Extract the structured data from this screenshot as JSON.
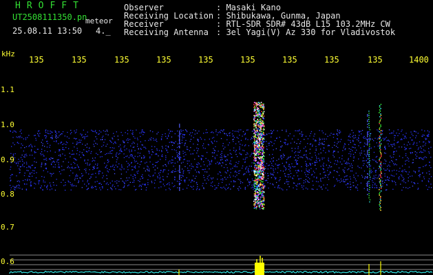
{
  "header": {
    "title": "HROFFT",
    "filename": "UT2508111350.pn",
    "type": "meteor",
    "datetime": "25.08.11 13:50",
    "version": "4._"
  },
  "meta": [
    {
      "label": "Observer",
      "value": ": Masaki Kano"
    },
    {
      "label": "Receiving Location",
      "value": ": Shibukawa, Gunma, Japan"
    },
    {
      "label": "Receiver",
      "value": ": RTL-SDR SDR# 43dB L15 103.2MHz CW"
    },
    {
      "label": "Receiving Antenna",
      "value": ": 3el Yagi(V) Az 330 for Vladivostok"
    }
  ],
  "axis": {
    "y_unit": "kHz",
    "y_ticks": [
      "1.1",
      "1.0",
      "0.9",
      "0.8",
      "0.7",
      "0.6"
    ],
    "x_ticks": [
      "135",
      "135",
      "135",
      "135",
      "135",
      "135",
      "135",
      "135",
      "135",
      "1400"
    ]
  },
  "colors": {
    "background": "#000000",
    "header_green": "#33e033",
    "header_white": "#e8e8e8",
    "tick_yellow": "#ffff33",
    "noise_blue": "#2a35ff",
    "spectrum_cyan": "#33e6e6",
    "spectrum_yellow": "#ffff00"
  }
}
